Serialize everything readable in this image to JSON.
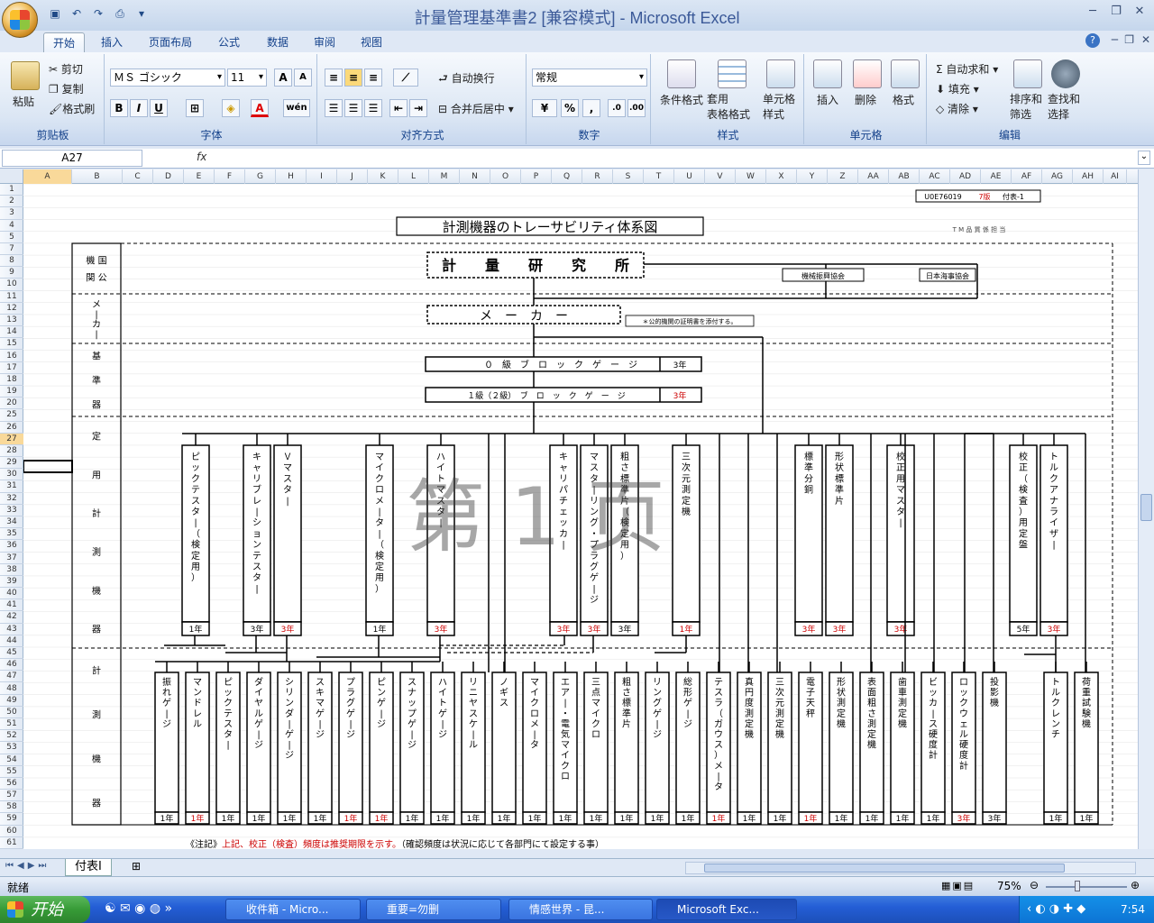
{
  "window": {
    "title": "計量管理基準書2 [兼容模式] - Microsoft Excel"
  },
  "tabs": [
    "开始",
    "插入",
    "页面布局",
    "公式",
    "数据",
    "审阅",
    "视图"
  ],
  "ribbon": {
    "clipboard": {
      "paste": "粘贴",
      "cut": "剪切",
      "copy": "复制",
      "format_painter": "格式刷",
      "label": "剪贴板"
    },
    "font": {
      "name": "ＭＳ ゴシック",
      "size": "11",
      "grow": "A",
      "shrink": "A",
      "label": "字体"
    },
    "alignment": {
      "wrap": "自动换行",
      "merge": "合并后居中",
      "label": "对齐方式"
    },
    "number": {
      "format": "常规",
      "label": "数字"
    },
    "styles": {
      "cond": "条件格式",
      "table": "套用\n表格格式",
      "cell": "单元格\n样式",
      "label": "样式"
    },
    "cells": {
      "insert": "插入",
      "delete": "删除",
      "format": "格式",
      "label": "单元格"
    },
    "editing": {
      "autosum": "自动求和",
      "fill": "填充",
      "clear": "清除",
      "sort": "排序和\n筛选",
      "find": "查找和\n选择",
      "label": "编辑"
    }
  },
  "formula_bar": {
    "name_box": "A27",
    "fx": "fx",
    "value": ""
  },
  "columns": [
    "A",
    "B",
    "C",
    "D",
    "E",
    "F",
    "G",
    "H",
    "I",
    "J",
    "K",
    "L",
    "M",
    "N",
    "O",
    "P",
    "Q",
    "R",
    "S",
    "T",
    "U",
    "V",
    "W",
    "X",
    "Y",
    "Z",
    "AA",
    "AB",
    "AC",
    "AD",
    "AE",
    "AF",
    "AG",
    "AH",
    "AI"
  ],
  "rows": [
    "1",
    "2",
    "3",
    "4",
    "5",
    "7",
    "8",
    "9",
    "10",
    "11",
    "12",
    "13",
    "14",
    "15",
    "16",
    "17",
    "18",
    "19",
    "20",
    "25",
    "26",
    "27",
    "28",
    "29",
    "30",
    "31",
    "32",
    "33",
    "34",
    "35",
    "36",
    "37",
    "38",
    "39",
    "40",
    "41",
    "42",
    "43",
    "44",
    "45",
    "46",
    "47",
    "48",
    "49",
    "50",
    "51",
    "52",
    "53",
    "54",
    "55",
    "56",
    "57",
    "58",
    "59",
    "60",
    "61"
  ],
  "doc": {
    "code": "U0E76019  7版  付表-1",
    "doc_code": "U0E76019",
    "edition": "7版",
    "appendix": "付表-1",
    "title": "計測機器のトレーサビリティ体系図",
    "approval": "T  M  品  質  係  担  当",
    "watermark": "第 1 页",
    "sections": [
      {
        "label": "機 国\n関 公",
        "y": [
          70,
          122
        ]
      },
      {
        "label": "メ\n|\nカ\n|",
        "y": [
          122,
          177
        ]
      },
      {
        "label": "基\n\n準\n\n器",
        "y": [
          177,
          258
        ]
      },
      {
        "label": "定\n\n用\n\n計\n\n測\n\n機\n\n器",
        "y": [
          258,
          515
        ]
      },
      {
        "label": "計\n\n測\n\n機\n\n器",
        "y": [
          515,
          711
        ]
      }
    ],
    "nmij": "計　　量　　研　　究　　所",
    "jmi": "機械振興協会",
    "nkk": "日本海事協会",
    "maker": "メ　ー　カ　ー",
    "maker_note": "＊公的機関の証明書を添付する。",
    "block0": "０　級　ブ　ロ　ッ　ク　ゲ　ー　ジ",
    "block0_p": "3年",
    "block1": "１級（２級）　ブ　ロ　ッ　ク　ゲ　ー　ジ",
    "block1_p": "3年",
    "standards": [
      {
        "label": "ピックテスター（検定用）",
        "period": "1年",
        "red": false
      },
      {
        "label": "キャリブレーションテスター",
        "period": "3年",
        "red": false
      },
      {
        "label": "Ｖマスター",
        "period": "3年",
        "red": true
      },
      {
        "label": "マイクロメーター（検定用）",
        "period": "1年",
        "red": false
      },
      {
        "label": "ハイトマスター",
        "period": "3年",
        "red": true
      },
      {
        "label": "キャリパチェッカー",
        "period": "3年",
        "red": true
      },
      {
        "label": "マスターリング・プラグゲージ",
        "period": "3年",
        "red": true
      },
      {
        "label": "粗さ標準片（検定用）",
        "period": "3年",
        "red": false
      },
      {
        "label": "三次元測定機",
        "period": "1年",
        "red": true
      },
      {
        "label": "標準分銅",
        "period": "3年",
        "red": true
      },
      {
        "label": "形状標準片",
        "period": "3年",
        "red": true
      },
      {
        "label": "校正用マスター",
        "period": "3年",
        "red": true
      },
      {
        "label": "校正（検査）用定盤",
        "period": "5年",
        "red": false
      },
      {
        "label": "トルクアナライザー",
        "period": "3年",
        "red": true
      }
    ],
    "instruments": [
      {
        "label": "振れゲージ",
        "period": "1年",
        "red": false
      },
      {
        "label": "マンドレル",
        "period": "1年",
        "red": true
      },
      {
        "label": "ピックテスター",
        "period": "1年",
        "red": false
      },
      {
        "label": "ダイヤルゲージ",
        "period": "1年",
        "red": false
      },
      {
        "label": "シリンダーゲージ",
        "period": "1年",
        "red": false
      },
      {
        "label": "スキマゲージ",
        "period": "1年",
        "red": false
      },
      {
        "label": "プラグゲージ",
        "period": "1年",
        "red": true
      },
      {
        "label": "ピンゲージ",
        "period": "1年",
        "red": true
      },
      {
        "label": "スナップゲージ",
        "period": "1年",
        "red": false
      },
      {
        "label": "ハイトゲージ",
        "period": "1年",
        "red": false
      },
      {
        "label": "リニヤスケール",
        "period": "1年",
        "red": false
      },
      {
        "label": "ノギス",
        "period": "1年",
        "red": false
      },
      {
        "label": "マイクロメータ",
        "period": "1年",
        "red": false
      },
      {
        "label": "エアー・電気マイクロ",
        "period": "1年",
        "red": false
      },
      {
        "label": "三点マイクロ",
        "period": "1年",
        "red": false
      },
      {
        "label": "粗さ標準片",
        "period": "1年",
        "red": false
      },
      {
        "label": "リングゲージ",
        "period": "1年",
        "red": false
      },
      {
        "label": "総形ゲージ",
        "period": "1年",
        "red": false
      },
      {
        "label": "テスラ（ガウス）メータ",
        "period": "1年",
        "red": true
      },
      {
        "label": "真円度測定機",
        "period": "1年",
        "red": false
      },
      {
        "label": "三次元測定機",
        "period": "1年",
        "red": false
      },
      {
        "label": "電子天秤",
        "period": "1年",
        "red": true
      },
      {
        "label": "形状測定機",
        "period": "1年",
        "red": false
      },
      {
        "label": "表面粗さ測定機",
        "period": "1年",
        "red": false
      },
      {
        "label": "歯車測定機",
        "period": "1年",
        "red": false
      },
      {
        "label": "ビッカース硬度計",
        "period": "1年",
        "red": false
      },
      {
        "label": "ロックウェル硬度計",
        "period": "3年",
        "red": true
      },
      {
        "label": "投影機",
        "period": "3年",
        "red": false
      },
      {
        "label": "トルクレンチ",
        "period": "1年",
        "red": false
      },
      {
        "label": "荷重試験機",
        "period": "1年",
        "red": false
      }
    ],
    "note_prefix": "《注記》",
    "note_red": "上記、校正（検査）頻度は推奨期限を示す。",
    "note_black": "（確認頻度は状況に応じて各部門にて設定する事）"
  },
  "sheet_tab": "付表Ⅰ",
  "status": {
    "ready": "就绪",
    "zoom": "75%"
  },
  "taskbar": {
    "start": "开始",
    "items": [
      "收件箱 - Micro...",
      "重要=勿删",
      "情感世界 - 昆...",
      "Microsoft Exc..."
    ],
    "time": "7:54"
  }
}
